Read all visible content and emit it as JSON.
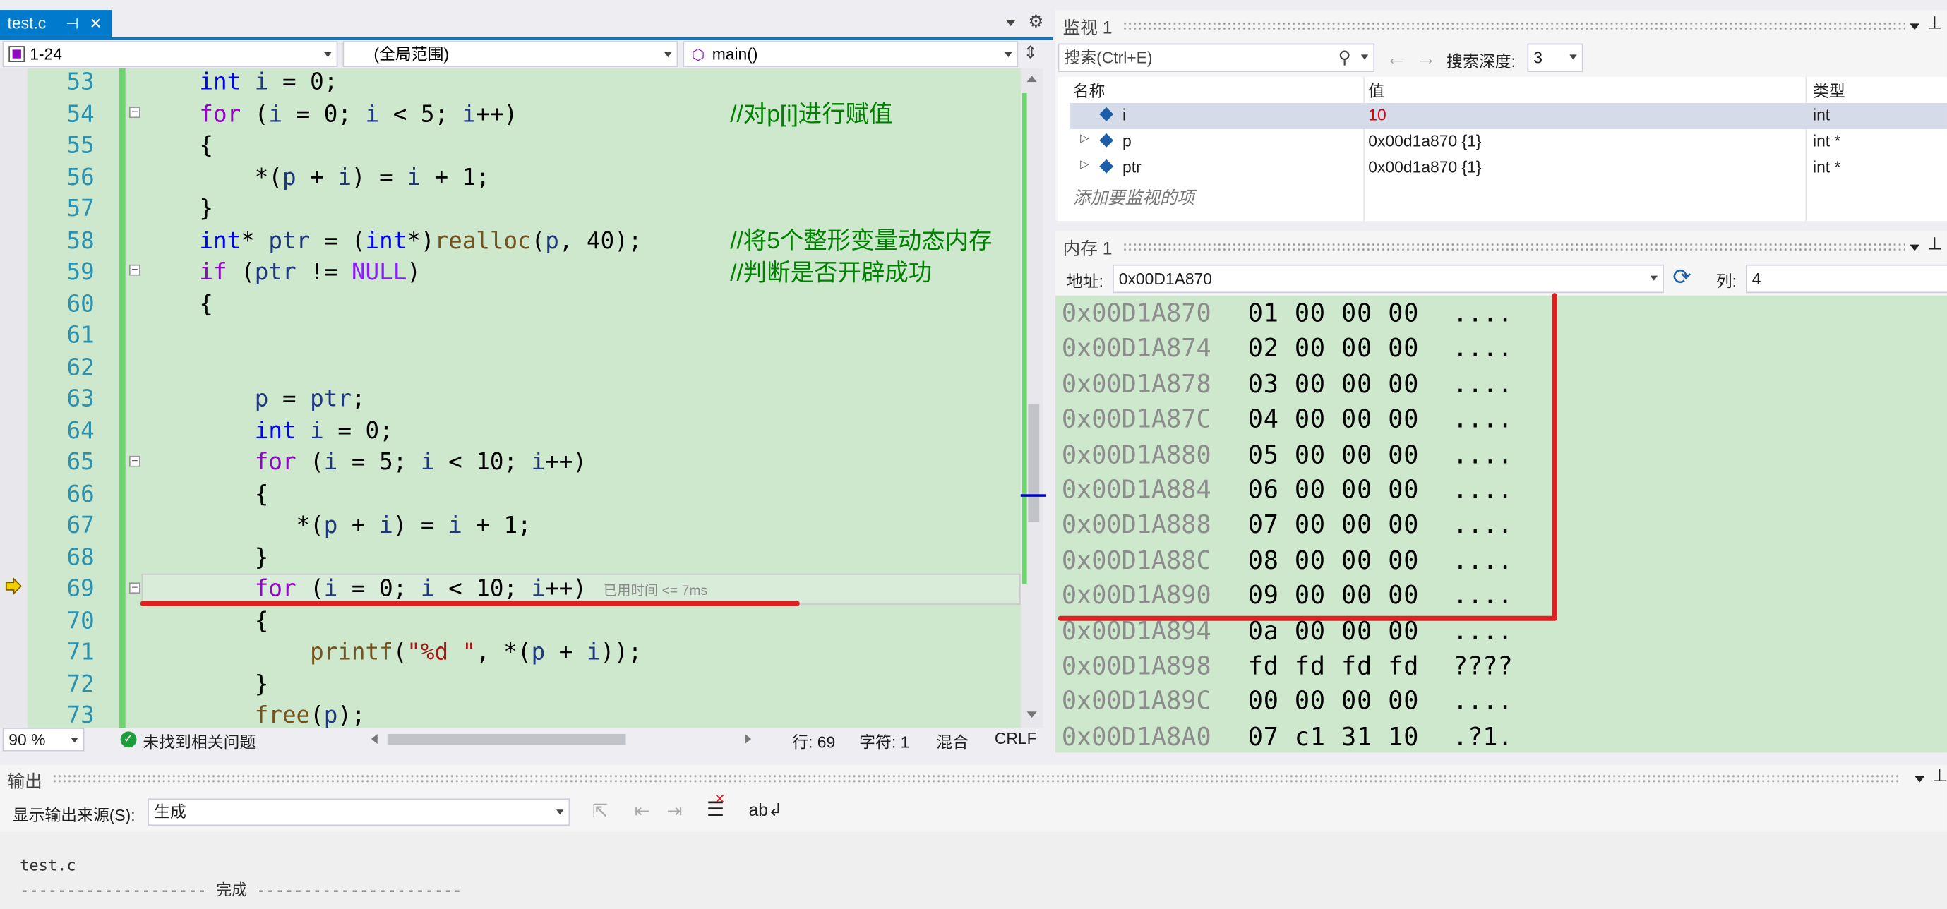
{
  "editor": {
    "tab_title": "test.c",
    "tab_pin": "⊣",
    "tab_close": "✕",
    "nav_left": "1-24",
    "nav_mid": "(全局范围)",
    "nav_right": "main()",
    "zoom": "90 %",
    "issues": "未找到相关问题",
    "status_line": "行: 69",
    "status_char": "字符: 1",
    "status_mix": "混合",
    "status_eol": "CRLF",
    "elapsed_hint": "已用时间 <= 7ms",
    "lines": [
      {
        "n": "53"
      },
      {
        "n": "54"
      },
      {
        "n": "55"
      },
      {
        "n": "56"
      },
      {
        "n": "57"
      },
      {
        "n": "58"
      },
      {
        "n": "59"
      },
      {
        "n": "60"
      },
      {
        "n": "61"
      },
      {
        "n": "62"
      },
      {
        "n": "63"
      },
      {
        "n": "64"
      },
      {
        "n": "65"
      },
      {
        "n": "66"
      },
      {
        "n": "67"
      },
      {
        "n": "68"
      },
      {
        "n": "69"
      },
      {
        "n": "70"
      },
      {
        "n": "71"
      },
      {
        "n": "72"
      },
      {
        "n": "73"
      }
    ],
    "comments": {
      "c54": "//对p[i]进行赋值",
      "c58": "//将5个整形变量动态内存",
      "c59": "//判断是否开辟成功"
    }
  },
  "watch": {
    "title": "监视 1",
    "search_placeholder": "搜索(Ctrl+E)",
    "depth_label": "搜索深度:",
    "depth_value": "3",
    "col_name": "名称",
    "col_value": "值",
    "col_type": "类型",
    "rows": [
      {
        "name": "i",
        "value": "10",
        "type": "int"
      },
      {
        "name": "p",
        "value": "0x00d1a870 {1}",
        "type": "int *"
      },
      {
        "name": "ptr",
        "value": "0x00d1a870 {1}",
        "type": "int *"
      }
    ],
    "add_hint": "添加要监视的项"
  },
  "memory": {
    "title": "内存 1",
    "addr_label": "地址:",
    "addr_value": "0x00D1A870",
    "col_label": "列:",
    "col_value": "4",
    "rows": [
      {
        "addr": "0x00D1A870",
        "bytes": "01 00 00 00",
        "ascii": "...."
      },
      {
        "addr": "0x00D1A874",
        "bytes": "02 00 00 00",
        "ascii": "...."
      },
      {
        "addr": "0x00D1A878",
        "bytes": "03 00 00 00",
        "ascii": "...."
      },
      {
        "addr": "0x00D1A87C",
        "bytes": "04 00 00 00",
        "ascii": "...."
      },
      {
        "addr": "0x00D1A880",
        "bytes": "05 00 00 00",
        "ascii": "...."
      },
      {
        "addr": "0x00D1A884",
        "bytes": "06 00 00 00",
        "ascii": "...."
      },
      {
        "addr": "0x00D1A888",
        "bytes": "07 00 00 00",
        "ascii": "...."
      },
      {
        "addr": "0x00D1A88C",
        "bytes": "08 00 00 00",
        "ascii": "...."
      },
      {
        "addr": "0x00D1A890",
        "bytes": "09 00 00 00",
        "ascii": "...."
      },
      {
        "addr": "0x00D1A894",
        "bytes": "0a 00 00 00",
        "ascii": "...."
      },
      {
        "addr": "0x00D1A898",
        "bytes": "fd fd fd fd",
        "ascii": "????"
      },
      {
        "addr": "0x00D1A89C",
        "bytes": "00 00 00 00",
        "ascii": "...."
      },
      {
        "addr": "0x00D1A8A0",
        "bytes": "07 c1 31 10",
        "ascii": ".?1."
      }
    ]
  },
  "output": {
    "title": "输出",
    "source_label": "显示输出来源(S):",
    "source_value": "生成",
    "line1": "test.c",
    "line2": "-------------------- 完成 ----------------------"
  },
  "colors": {
    "accent": "#007acc",
    "code_bg": "#cde8cd",
    "annotation_red": "#e02020"
  }
}
